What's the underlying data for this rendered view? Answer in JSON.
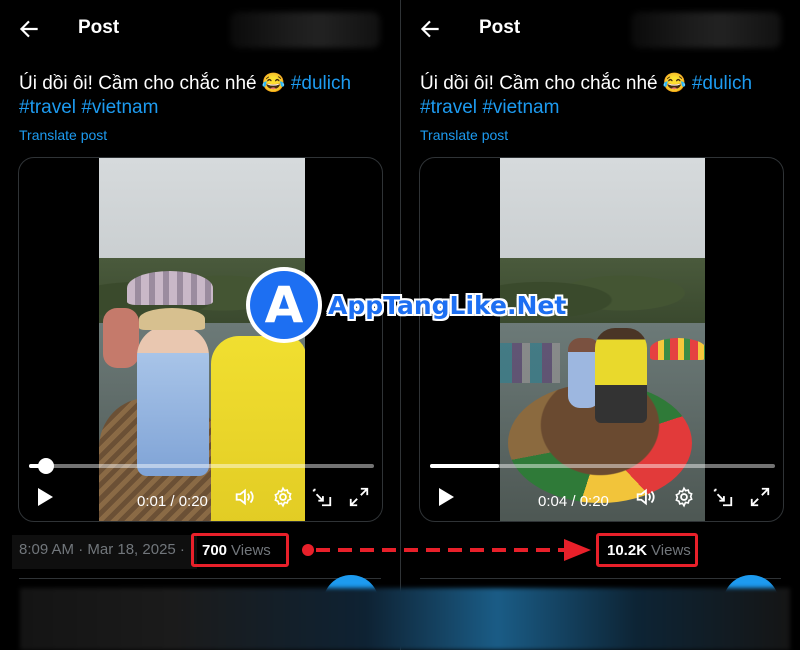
{
  "panels": [
    {
      "header_title": "Post",
      "post_text": "Úi dồi ôi! Cầm cho chắc nhé 😂",
      "hashtags": [
        "#dulich",
        "#travel",
        "#vietnam"
      ],
      "translate_label": "Translate post",
      "video_time": "0:01 / 0:20",
      "video_progress": 0.05,
      "meta_text": "8:09 AM · Mar 18, 2025 ·",
      "views_count": "700",
      "views_label": "Views"
    },
    {
      "header_title": "Post",
      "post_text": "Úi dồi ôi! Cầm cho chắc nhé 😂",
      "hashtags": [
        "#dulich",
        "#travel",
        "#vietnam"
      ],
      "translate_label": "Translate post",
      "video_time": "0:04 / 0:20",
      "video_progress": 0.2,
      "meta_text": "",
      "views_count": "10.2K",
      "views_label": "Views"
    }
  ],
  "watermark": {
    "letter": "A",
    "text": "AppTangLike.Net"
  },
  "icons": {
    "back": "arrow-left-icon",
    "play": "play-icon",
    "volume": "volume-icon",
    "settings": "gear-icon",
    "pip": "picture-in-picture-icon",
    "fullscreen": "fullscreen-icon"
  },
  "colors": {
    "accent": "#1d9bf0",
    "highlight": "#e8202a",
    "watermark": "#1d6ff2"
  }
}
